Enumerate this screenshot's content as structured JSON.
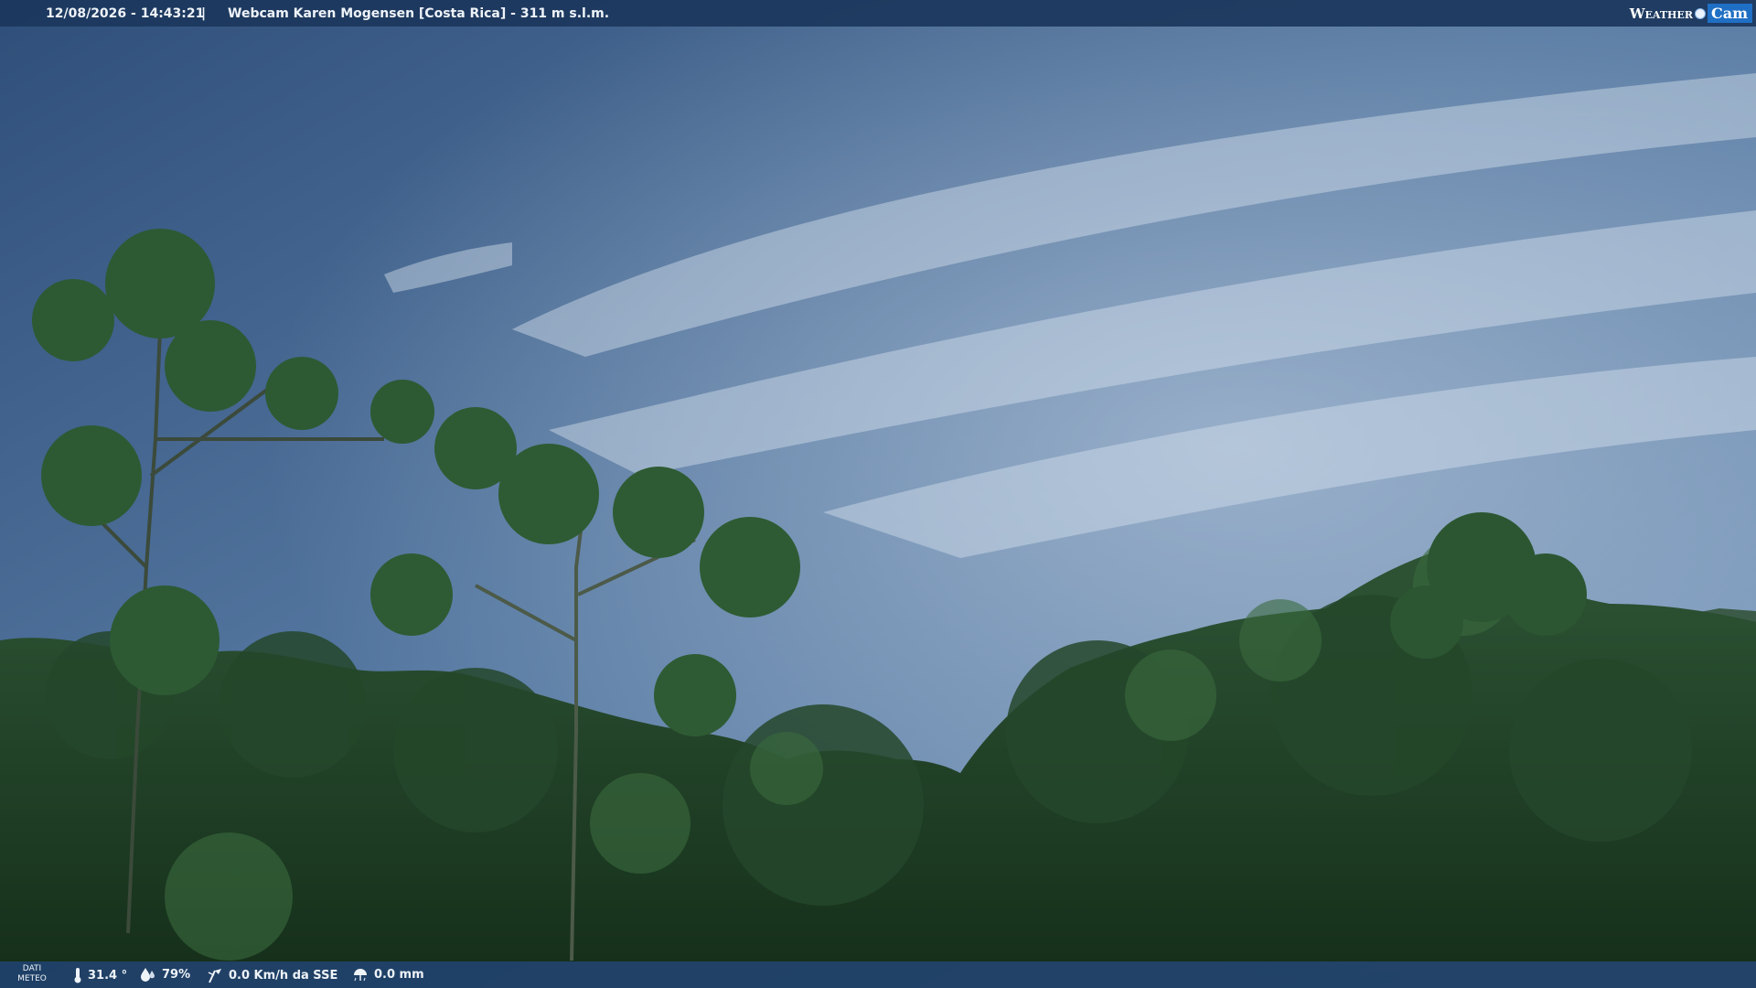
{
  "header": {
    "datetime": "12/08/2026 - 14:43:21",
    "separator": "|",
    "title": "Webcam Karen Mogensen [Costa Rica] - 311 m s.l.m.",
    "logo": {
      "word": "Weather",
      "cam": "Cam"
    }
  },
  "footer": {
    "label_line1": "DATI",
    "label_line2": "METEO",
    "temperature": "31.4 °",
    "humidity": "79%",
    "wind": "0.0 Km/h da SSE",
    "rain": "0.0 mm",
    "icons": [
      "thermometer-icon",
      "humidity-icon",
      "wind-icon",
      "rain-icon"
    ]
  },
  "colors": {
    "bar_bg": "#1c375c",
    "logo_accent": "#1f6fc4",
    "sky_top": "#34557f",
    "foliage": "#1e3f24"
  }
}
